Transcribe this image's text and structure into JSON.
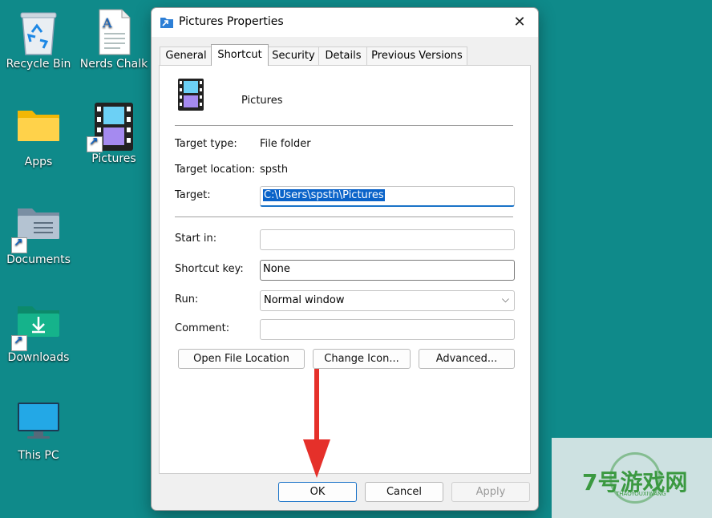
{
  "desktop": {
    "icons": [
      {
        "label": "Recycle Bin",
        "icon": "recycle-bin-icon"
      },
      {
        "label": "Nerds Chalk",
        "icon": "text-document-icon"
      },
      {
        "label": "Apps",
        "icon": "folder-icon"
      },
      {
        "label": "Pictures",
        "icon": "film-folder-shortcut-icon"
      },
      {
        "label": "Documents",
        "icon": "documents-folder-shortcut-icon"
      },
      {
        "label": "Downloads",
        "icon": "downloads-folder-shortcut-icon"
      },
      {
        "label": "This PC",
        "icon": "monitor-icon"
      }
    ],
    "background_color": "#0f8a8a"
  },
  "dialog": {
    "title": "Pictures Properties",
    "close_symbol": "✕",
    "tabs": [
      {
        "label": "General"
      },
      {
        "label": "Shortcut",
        "active": true
      },
      {
        "label": "Security"
      },
      {
        "label": "Details"
      },
      {
        "label": "Previous Versions"
      }
    ],
    "header_name": "Pictures",
    "fields": {
      "target_type_label": "Target type:",
      "target_type_value": "File folder",
      "target_location_label": "Target location:",
      "target_location_value": "spsth",
      "target_label": "Target:",
      "target_value": "C:\\Users\\spsth\\Pictures",
      "start_in_label": "Start in:",
      "start_in_value": "",
      "shortcut_key_label": "Shortcut key:",
      "shortcut_key_value": "None",
      "run_label": "Run:",
      "run_value": "Normal window",
      "comment_label": "Comment:",
      "comment_value": ""
    },
    "action_buttons": {
      "open_file_location": "Open File Location",
      "change_icon": "Change Icon...",
      "advanced": "Advanced..."
    },
    "footer_buttons": {
      "ok": "OK",
      "cancel": "Cancel",
      "apply": "Apply"
    },
    "accent_color": "#1a73c8"
  },
  "annotation": {
    "arrow_color": "#e5302a"
  },
  "watermark": {
    "text": "7号游戏网",
    "subtext": "THAOYOUXIWANG"
  }
}
